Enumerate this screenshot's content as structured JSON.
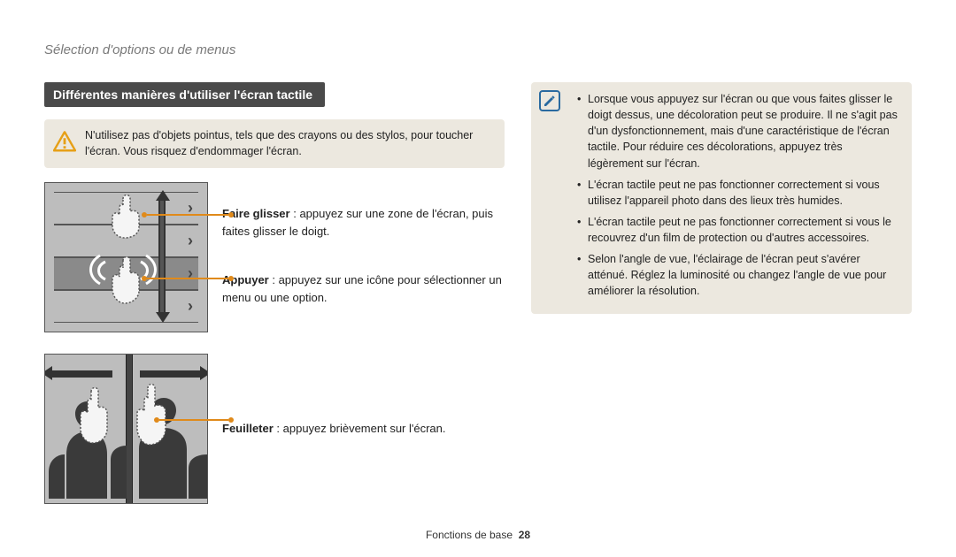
{
  "section_title": "Sélection d'options ou de menus",
  "subheading": "Différentes manières d'utiliser l'écran tactile",
  "warning_text": "N'utilisez pas d'objets pointus, tels que des crayons ou des stylos, pour toucher l'écran. Vous risquez d'endommager l'écran.",
  "gestures": [
    {
      "label": "Faire glisser",
      "desc": " : appuyez sur une zone de l'écran, puis faites glisser le doigt."
    },
    {
      "label": "Appuyer",
      "desc": " : appuyez sur une icône pour sélectionner un menu ou une option."
    },
    {
      "label": "Feuilleter",
      "desc": " : appuyez brièvement sur l'écran."
    }
  ],
  "notes": [
    "Lorsque vous appuyez sur l'écran ou que vous faites glisser le doigt dessus, une décoloration peut se produire. Il ne s'agit pas d'un dysfonctionnement, mais d'une caractéristique de l'écran tactile. Pour réduire ces décolorations, appuyez très légèrement sur l'écran.",
    "L'écran tactile peut ne pas fonctionner correctement si vous utilisez l'appareil photo dans des lieux très humides.",
    "L'écran tactile peut ne pas fonctionner correctement si vous le recouvrez d'un film de protection ou d'autres accessoires.",
    "Selon l'angle de vue, l'éclairage de l'écran peut s'avérer atténué. Réglez la luminosité ou changez l'angle de vue pour améliorer la résolution."
  ],
  "footer_label": "Fonctions de base",
  "page_number": "28",
  "icons": {
    "warning": "warning-triangle-icon",
    "note": "note-pencil-icon"
  }
}
